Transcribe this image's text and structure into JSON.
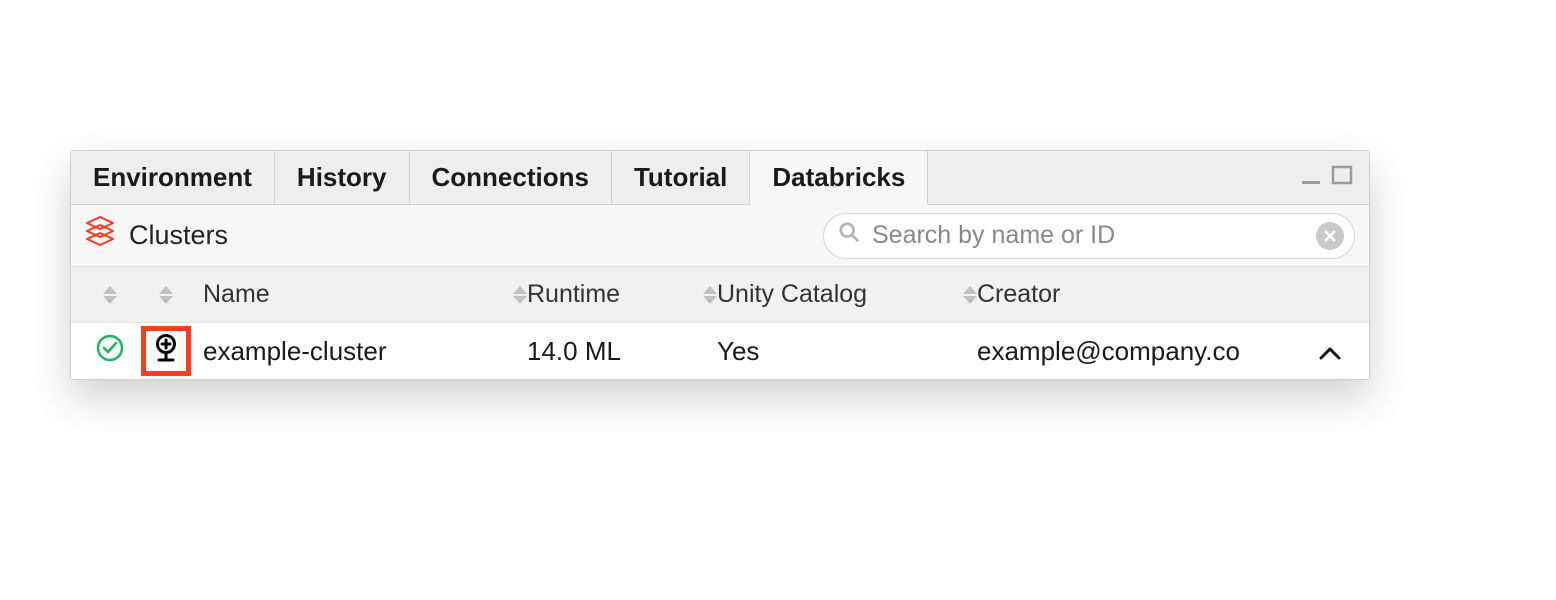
{
  "tabs": [
    {
      "label": "Environment",
      "active": false
    },
    {
      "label": "History",
      "active": false
    },
    {
      "label": "Connections",
      "active": false
    },
    {
      "label": "Tutorial",
      "active": false
    },
    {
      "label": "Databricks",
      "active": true
    }
  ],
  "toolbar": {
    "section_title": "Clusters",
    "search_placeholder": "Search by name or ID",
    "search_value": ""
  },
  "columns": {
    "name": "Name",
    "runtime": "Runtime",
    "unity_catalog": "Unity Catalog",
    "creator": "Creator"
  },
  "rows": [
    {
      "status": "running",
      "name": "example-cluster",
      "runtime": "14.0 ML",
      "unity_catalog": "Yes",
      "creator": "example@company.co"
    }
  ],
  "highlight": {
    "target": "connect-icon",
    "color": "#ff3b1f"
  }
}
